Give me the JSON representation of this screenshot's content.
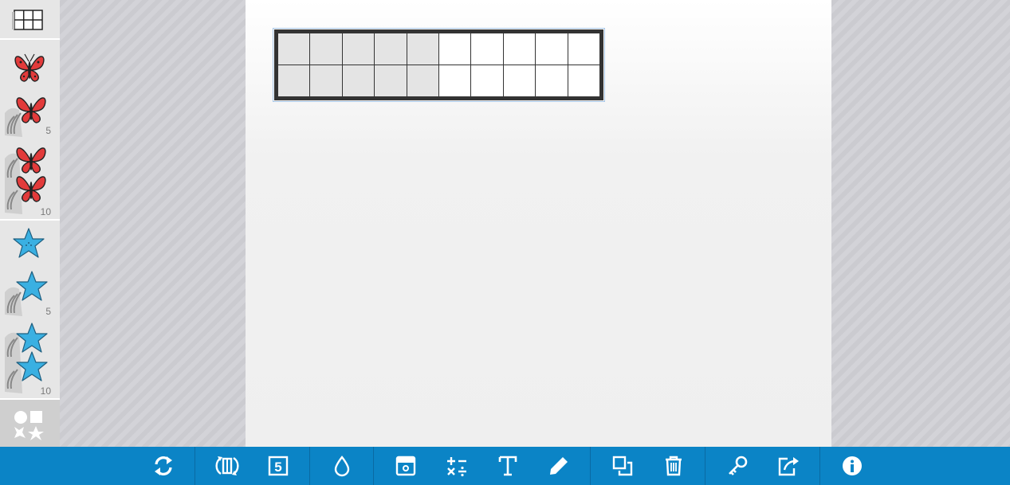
{
  "sidebar": {
    "items": [
      {
        "name": "ten-frame-tool",
        "icon": "grid-icon"
      },
      {
        "name": "butterfly-1",
        "icon": "butterfly-icon",
        "color": "#e23b3b"
      },
      {
        "name": "butterfly-5",
        "icon": "butterfly-stack-icon",
        "count": "5"
      },
      {
        "name": "butterfly-10",
        "icon": "butterfly-double-stack-icon",
        "count": "10"
      },
      {
        "name": "starfish-1",
        "icon": "starfish-icon",
        "color": "#3ab0e2"
      },
      {
        "name": "starfish-5",
        "icon": "starfish-stack-icon",
        "count": "5"
      },
      {
        "name": "starfish-10",
        "icon": "starfish-double-stack-icon",
        "count": "10"
      },
      {
        "name": "shapes",
        "icon": "shapes-icon"
      }
    ]
  },
  "ten_frame": {
    "columns": 10,
    "rows": 2,
    "shaded_columns": 5
  },
  "toolbar": {
    "buttons": [
      {
        "name": "reset-button",
        "icon": "refresh-icon"
      },
      {
        "name": "flip-button",
        "icon": "flip-icon"
      },
      {
        "name": "number-button",
        "icon": "number-five-icon"
      },
      {
        "name": "color-button",
        "icon": "droplet-icon"
      },
      {
        "name": "background-button",
        "icon": "window-icon"
      },
      {
        "name": "operations-button",
        "icon": "math-operators-icon"
      },
      {
        "name": "text-button",
        "icon": "text-icon"
      },
      {
        "name": "draw-button",
        "icon": "pencil-icon"
      },
      {
        "name": "duplicate-button",
        "icon": "duplicate-icon"
      },
      {
        "name": "delete-button",
        "icon": "trash-icon"
      },
      {
        "name": "key-button",
        "icon": "key-icon"
      },
      {
        "name": "share-button",
        "icon": "share-icon"
      },
      {
        "name": "info-button",
        "icon": "info-icon"
      }
    ]
  },
  "colors": {
    "toolbar": "#0b84c6",
    "butterfly": "#e23b3b",
    "starfish": "#3ab0e2"
  }
}
